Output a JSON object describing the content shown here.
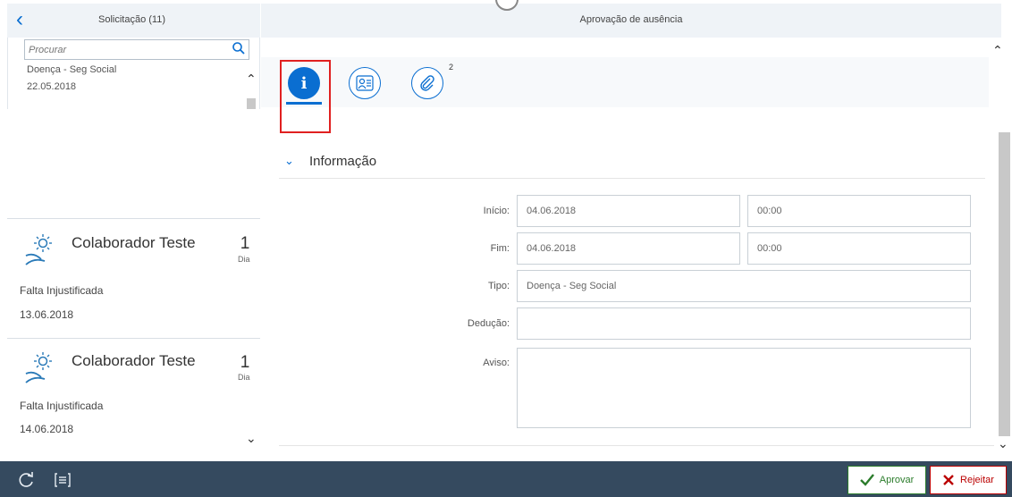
{
  "left": {
    "title": "Solicitação (11)",
    "search_placeholder": "Procurar",
    "first_item": {
      "title": "Doença - Seg Social",
      "date": "22.05.2018"
    },
    "cards": [
      {
        "name": "Colaborador Teste",
        "count": "1",
        "unit": "Dia",
        "type": "Falta Injustificada",
        "date": "13.06.2018"
      },
      {
        "name": "Colaborador Teste",
        "count": "1",
        "unit": "Dia",
        "type": "Falta Injustificada",
        "date": "14.06.2018"
      }
    ]
  },
  "right": {
    "title": "Aprovação de ausência",
    "tabs": {
      "info_glyph": "i",
      "attach_count": "2"
    },
    "section_title": "Informação",
    "fields": {
      "inicio_label": "Início:",
      "inicio_date": "04.06.2018",
      "inicio_time": "00:00",
      "fim_label": "Fim:",
      "fim_date": "04.06.2018",
      "fim_time": "00:00",
      "tipo_label": "Tipo:",
      "tipo_value": "Doença - Seg Social",
      "deducao_label": "Dedução:",
      "aviso_label": "Aviso:"
    }
  },
  "footer": {
    "approve_label": "Aprovar",
    "reject_label": "Rejeitar"
  },
  "icons": [
    "back-arrow-icon",
    "search-icon",
    "chevron-up-icon",
    "chevron-down-icon",
    "sun-icon",
    "refresh-icon",
    "list-icon",
    "info-icon",
    "people-icon",
    "attachment-icon",
    "check-icon",
    "cross-icon"
  ],
  "colors": {
    "accent": "#0a6ed1",
    "footer": "#354a5f",
    "approve": "#2b7c2b",
    "reject": "#bb0000",
    "highlight": "#e02020"
  }
}
